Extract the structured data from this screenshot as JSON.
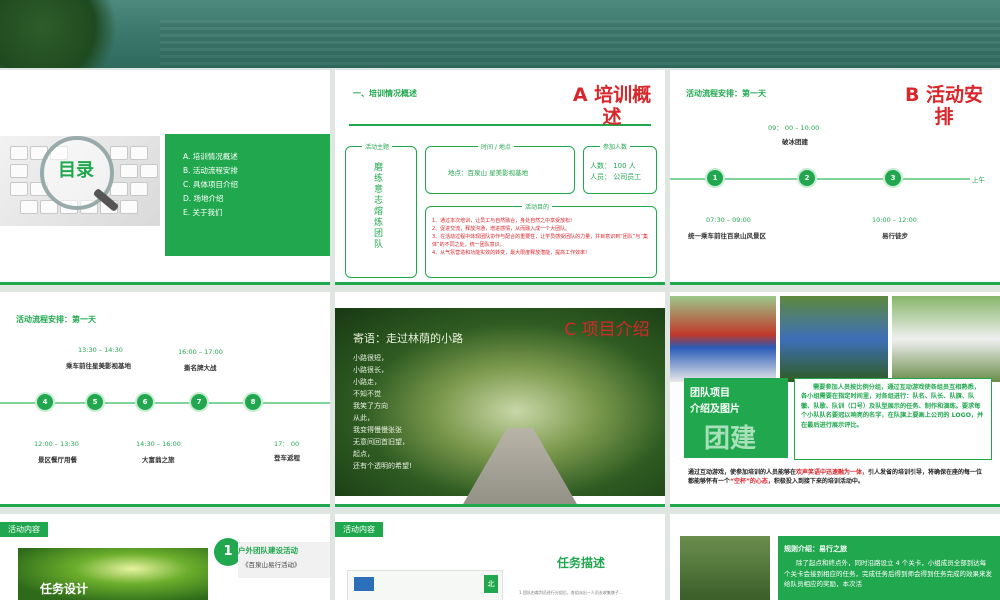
{
  "colors": {
    "accent": "#21a84f",
    "red": "#d8262b"
  },
  "slide1": {
    "toc_title": "目录",
    "items": [
      "A.  培训情况概述",
      "B.  活动流程安排",
      "C.  具体项目介绍",
      "D.  场地介绍",
      "E.  关于我们"
    ]
  },
  "slide2": {
    "section_title": "一、培训情况概述",
    "big_title": "A 培训概述",
    "theme_label": "活动主题",
    "theme_text": "磨练意志 熔炼团队",
    "time_label": "时间 / 地点",
    "place_text": "地点：百泉山   星美影视基地",
    "people_label": "参加人数",
    "people_count": "人数：  100 人",
    "people_who": "人员：  公司员工",
    "purpose_label": "活动目的",
    "purpose_lines": [
      "1、通过本次培训，让员工与自然融合，身处自然之中享受放松!",
      "2、促进交流，释放沟通，增进感情，从而融入成一个大团队。",
      "3、在活动过程中体现团队协作与配合的重要性，让学员感受团队的力量，并目意识到“团队”与“集体”的不同之处，统一团队意识。",
      "4、从气氛营造和功能实效的转变，最大限度释放潜能，提高工作效率!"
    ]
  },
  "slide3": {
    "flow_title": "活动流程安排：第一天",
    "big_title": "B 活动安排",
    "events": [
      {
        "num": "1",
        "time": "07:30 – 09:00",
        "text": "统一乘车前往百泉山风景区"
      },
      {
        "num": "2",
        "time": "09： 00 – 10:00",
        "text": "破冰团建"
      },
      {
        "num": "3",
        "time": "10:00 – 12:00",
        "text": "易行徒步"
      }
    ],
    "right_label": "上午"
  },
  "slide4": {
    "flow_title": "活动流程安排：第一天",
    "events": [
      {
        "num": "4",
        "time": "12:00 – 13:30",
        "text": "景区餐厅用餐"
      },
      {
        "num": "5",
        "time": "13:30 – 14:30",
        "text": "乘车前往星美影视基地"
      },
      {
        "num": "6",
        "time": "14:30 – 16:00",
        "text": "大富翁之旅"
      },
      {
        "num": "7",
        "time": "16:00 – 17:00",
        "text": "撕名牌大战"
      },
      {
        "num": "8",
        "time": "17： 00",
        "text": "登车返程"
      }
    ]
  },
  "slide5": {
    "motto_title": "寄语：走过林荫的小路",
    "big_title": "C 项目介绍",
    "poem_lines": [
      "小路很短，",
      "小路很长，",
      "小路走，",
      "不知不觉",
      "我笑了方向",
      "从此，",
      "我变得慢慢张张",
      "无意间回首旧望，",
      "起点，",
      "还有个透明的希望!"
    ]
  },
  "slide6": {
    "group_title_1": "团队项目",
    "group_title_2": "介绍及图片",
    "group_big": "团建",
    "desc": "需要参加人员按比例分组，通过互动游戏使各组员互相熟悉，各小组需要在指定时间里，对各组进行：队名、队长、队旗、队徽、队歌、队训（口号）及队型展示的任务、制作和演练。要求每个小队队名要冠以响亮的名字，在队旗上要画上公司的 LOGO，并在最后进行展示评比。",
    "bottom_pre": "通过互动游戏，使参加培训的人员能够在",
    "bottom_red1": "欢声笑语中迅速融为一体，",
    "bottom_mid": "引人发省的培训引导，将确保在座的每一位都能够怀有一个",
    "bottom_red2": "“空杯”的心态",
    "bottom_post": "，积极投入到接下来的培训活动中。"
  },
  "slide7": {
    "tag": "活动内容",
    "num": "1",
    "title": "户外团队建设活动",
    "subtitle": "《百泉山易行活动》",
    "task": "任务设计"
  },
  "slide8": {
    "tag": "活动内容",
    "task_desc": "任务描述",
    "north": "北",
    "note": "1  团队由裁判员进行分组后，各组派出一人员去收集旗子..."
  },
  "slide9": {
    "rule_label": "规则介绍：",
    "rule_title": "易行之旅",
    "rule_text": "除了起点和终点外，同时沿路设立 4 个关卡，小组成员全部到达每个关卡会接到相应的任务，完成任务后得到师会得到任务完成的效果来发给队员相应的奖励，本次活"
  }
}
